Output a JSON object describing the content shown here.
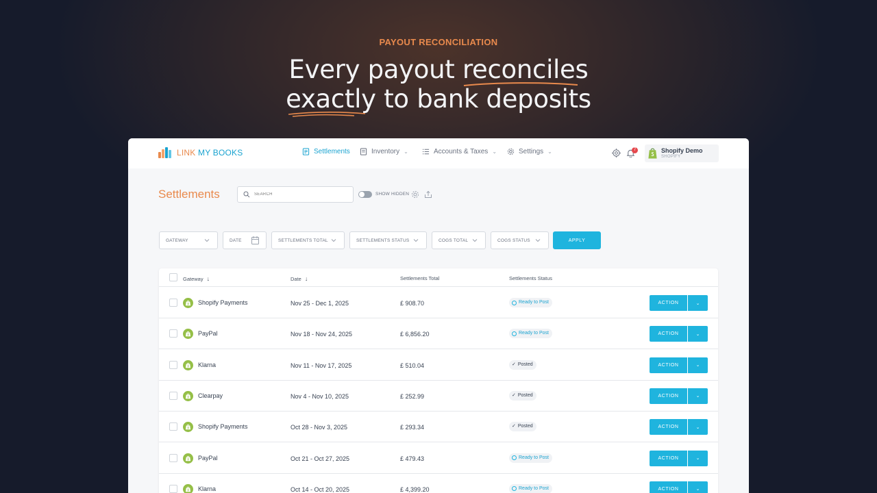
{
  "hero": {
    "eyebrow": "PAYOUT RECONCILIATION",
    "line1_a": "Every payout ",
    "line1_b": "reconciles",
    "line2_a": "exactly",
    "line2_b": " to bank deposits",
    "underline_color": "#e98a4d"
  },
  "brand": {
    "word1": "LINK",
    "word2": "MY BOOKS"
  },
  "nav": {
    "items": [
      {
        "label": "Settlements",
        "icon": "settlements-icon",
        "active": true
      },
      {
        "label": "Inventory",
        "icon": "inventory-icon",
        "active": false
      },
      {
        "label": "Accounts & Taxes",
        "icon": "accounts-icon",
        "active": false
      },
      {
        "label": "Settings",
        "icon": "gear-icon",
        "active": false
      }
    ],
    "notification_count": "7",
    "account": {
      "name": "Shopify Demo",
      "platform": "SHOPIFY"
    }
  },
  "page": {
    "title": "Settlements",
    "search_placeholder": "SEARCH",
    "show_hidden_label": "SHOW HIDDEN"
  },
  "filters": {
    "gateway": "GATEWAY",
    "date": "DATE",
    "settlements_total": "SETTLEMENTS TOTAL",
    "settlements_status": "SETTLEMENTS STATUS",
    "cogs_total": "COGS TOTAL",
    "cogs_status": "COGS STATUS",
    "apply": "APPLY"
  },
  "table": {
    "headers": {
      "gateway": "Gateway",
      "date": "Date",
      "total": "Settlements Total",
      "status": "Settlements Status"
    },
    "action_label": "ACTION",
    "rows": [
      {
        "gateway": "Shopify Payments",
        "date": "Nov 25 - Dec 1, 2025",
        "total": "£ 908.70",
        "status": "Ready to Post",
        "status_type": "ready"
      },
      {
        "gateway": "PayPal",
        "date": "Nov 18 - Nov 24, 2025",
        "total": "£ 6,856.20",
        "status": "Ready to Post",
        "status_type": "ready"
      },
      {
        "gateway": "Klarna",
        "date": "Nov 11 - Nov 17, 2025",
        "total": "£ 510.04",
        "status": "Posted",
        "status_type": "posted"
      },
      {
        "gateway": "Clearpay",
        "date": "Nov 4 - Nov 10, 2025",
        "total": "£ 252.99",
        "status": "Posted",
        "status_type": "posted"
      },
      {
        "gateway": "Shopify Payments",
        "date": "Oct 28 - Nov 3, 2025",
        "total": "£ 293.34",
        "status": "Posted",
        "status_type": "posted"
      },
      {
        "gateway": "PayPal",
        "date": "Oct 21 - Oct 27, 2025",
        "total": "£ 479.43",
        "status": "Ready to Post",
        "status_type": "ready"
      },
      {
        "gateway": "Klarna",
        "date": "Oct 14 - Oct 20, 2025",
        "total": "£ 4,399.20",
        "status": "Ready to Post",
        "status_type": "ready"
      }
    ]
  },
  "colors": {
    "accent": "#1fb4de",
    "brand_orange": "#e98a4d",
    "shopify_green": "#95bf47"
  }
}
